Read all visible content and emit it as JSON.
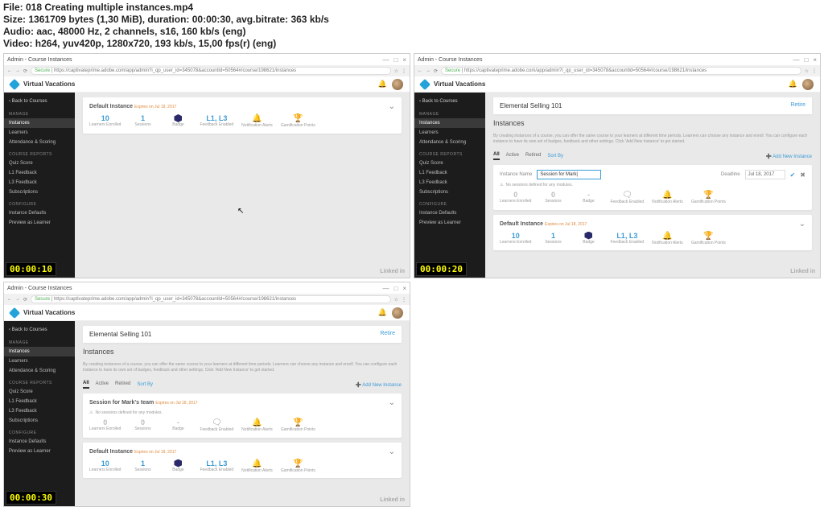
{
  "meta": {
    "file_line": "File: 018 Creating multiple instances.mp4",
    "size_line": "Size: 1361709 bytes (1,30 MiB), duration: 00:00:30, avg.bitrate: 363 kb/s",
    "audio_line": "Audio: aac, 48000 Hz, 2 channels, s16, 160 kb/s (eng)",
    "video_line": "Video: h264, yuv420p, 1280x720, 193 kb/s, 15,00 fps(r) (eng)"
  },
  "browser": {
    "tab_title": "Admin - Course Instances",
    "win_buttons": {
      "min": "—",
      "max": "□",
      "close": "×"
    },
    "nav": {
      "back": "←",
      "fwd": "→",
      "reload": "⟳"
    },
    "secure_label": "Secure",
    "url": "https://captivateprime.adobe.com/app/admin?i_qp_user_id=345078&accountId=50564#/course/198621/instances",
    "menu": "⋮",
    "star": "☆"
  },
  "app": {
    "brand": "Virtual Vacations",
    "bell": "🔔",
    "course_title": "Elemental Selling 101",
    "retire": "Retire",
    "instances_title": "Instances",
    "instances_desc": "By creating instances of a course, you can offer the same course to your learners at different time periods. Learners can choose any instance and enroll. You can configure each instance to have its own set of badges, feedback and other settings. Click 'Add New Instance' to get started.",
    "tabs": {
      "all": "All",
      "active": "Active",
      "retired": "Retired",
      "sort": "Sort By"
    },
    "add_new": "➕ Add New Instance",
    "warn_no_sessions": "No sessions defined for any modules.",
    "form": {
      "name_label": "Instance Name",
      "name_value_partial": "Session for Mark|",
      "deadline_label": "Deadline",
      "deadline_value": "Jul 18, 2017",
      "save": "✔",
      "cancel": "✖"
    },
    "mark_instance_title": "Session for Mark's team",
    "default_instance": "Default Instance",
    "expires": "Expires on Jul 18, 2017",
    "metrics": {
      "learners": {
        "v10": "10",
        "v1": "1",
        "v0": "0",
        "dash": "-",
        "lbl": "Learners Enrolled"
      },
      "sessions": {
        "lbl": "Sessions"
      },
      "badge": {
        "lbl": "Badge"
      },
      "feedback": {
        "v_l1l3": "L1, L3",
        "lbl": "Feedback Enabled"
      },
      "notif": {
        "lbl": "Notification Alerts"
      },
      "gamif": {
        "lbl": "Gamification Points"
      }
    }
  },
  "sidebar": {
    "back": "‹  Back to Courses",
    "sec_manage": "MANAGE",
    "items_manage": [
      "Instances",
      "Learners",
      "Attendance & Scoring"
    ],
    "sec_reports": "COURSE REPORTS",
    "items_reports": [
      "Quiz Score",
      "L1 Feedback",
      "L3 Feedback",
      "Subscriptions"
    ],
    "sec_config": "CONFIGURE",
    "items_config": [
      "Instance Defaults",
      "Preview as Learner"
    ]
  },
  "timestamps": {
    "t1": "00:00:10",
    "t2": "00:00:20",
    "t3": "00:00:30"
  },
  "watermark": "Linked in"
}
